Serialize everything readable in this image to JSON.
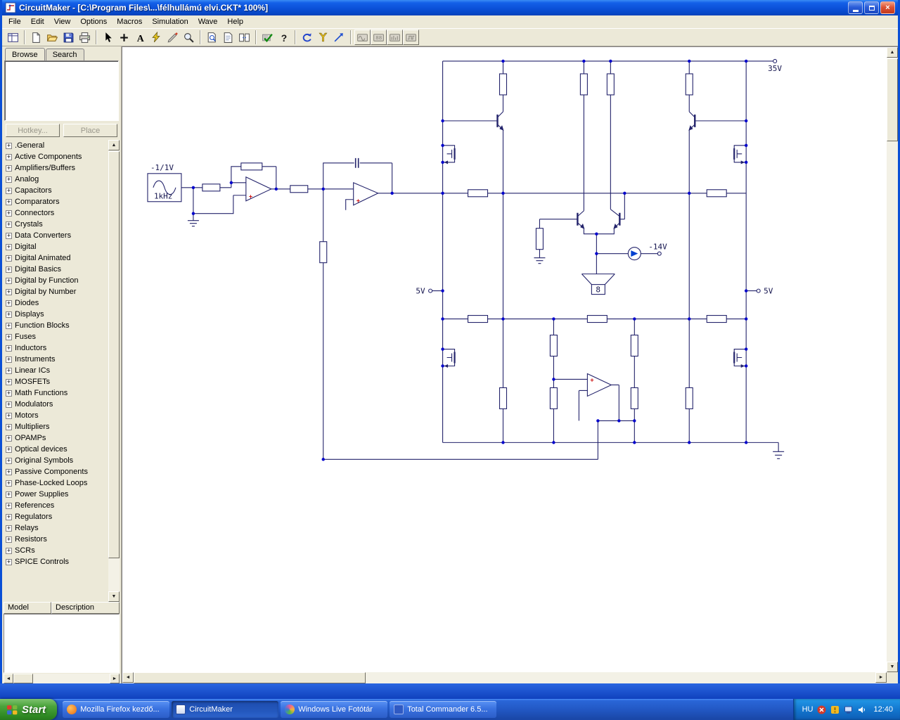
{
  "titlebar": {
    "title": "CircuitMaker - [C:\\Program Files\\...\\félhullámú elvi.CKT* 100%]"
  },
  "menu": {
    "items": [
      "File",
      "Edit",
      "View",
      "Options",
      "Macros",
      "Simulation",
      "Wave",
      "Help"
    ]
  },
  "toolbar": {
    "icons": [
      "browse-grid",
      "new-document",
      "open-folder",
      "save-floppy",
      "printer",
      "arrow-cursor",
      "place-plus",
      "text-a",
      "wire-lightning",
      "probe-pen",
      "zoom-magnifier",
      "page-magnifier",
      "page",
      "split-panes",
      "digital-check",
      "help-question",
      "reset-undo",
      "y-probe",
      "run-arrow",
      "instrument-wave",
      "instrument-digits",
      "instrument-bars",
      "instrument-logic"
    ]
  },
  "sidebar": {
    "tabs": [
      {
        "label": "Browse",
        "active": true
      },
      {
        "label": "Search",
        "active": false
      }
    ],
    "hotkey_button": "Hotkey...",
    "place_button": "Place",
    "categories": [
      ".General",
      "Active Components",
      "Amplifiers/Buffers",
      "Analog",
      "Capacitors",
      "Comparators",
      "Connectors",
      "Crystals",
      "Data Converters",
      "Digital",
      "Digital Animated",
      "Digital Basics",
      "Digital by Function",
      "Digital by Number",
      "Diodes",
      "Displays",
      "Function Blocks",
      "Fuses",
      "Inductors",
      "Instruments",
      "Linear ICs",
      "MOSFETs",
      "Math Functions",
      "Modulators",
      "Motors",
      "Multipliers",
      "OPAMPs",
      "Optical devices",
      "Original Symbols",
      "Passive Components",
      "Phase-Locked Loops",
      "Power Supplies",
      "References",
      "Regulators",
      "Relays",
      "Resistors",
      "SCRs",
      "SPICE Controls"
    ],
    "model_header": "Model",
    "description_header": "Description"
  },
  "schematic": {
    "source_amplitude": "-1/1V",
    "source_frequency": "1kHz",
    "supply_positive": "35V",
    "supply_negative": "-14V",
    "rail_left": "5V",
    "rail_right": "5V",
    "speaker_impedance": "8",
    "opamp_plus": "+"
  },
  "taskbar": {
    "start_label": "Start",
    "tasks": [
      {
        "label": "Mozilla Firefox kezdő...",
        "active": false
      },
      {
        "label": "CircuitMaker",
        "active": true
      },
      {
        "label": "Windows Live Fotótár",
        "active": false
      },
      {
        "label": "Total Commander 6.5...",
        "active": false
      }
    ],
    "language_indicator": "HU",
    "clock": "12:40"
  }
}
